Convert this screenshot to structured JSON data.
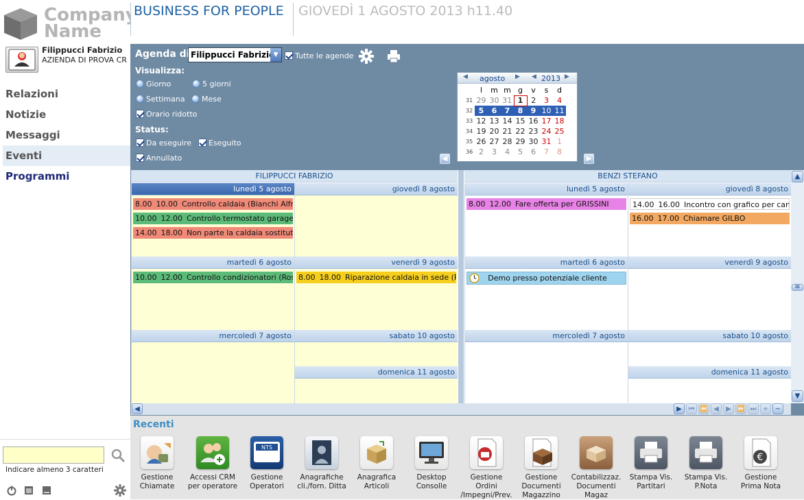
{
  "brand": {
    "company_line1": "Company",
    "company_line2": "Name"
  },
  "user": {
    "name": "Filippucci Fabrizio",
    "company": "AZIENDA DI PROVA CR"
  },
  "nav": [
    "Relazioni",
    "Notizie",
    "Messaggi",
    "Eventi",
    "Programmi"
  ],
  "search": {
    "value": "",
    "hint": "Indicare almeno 3 caratteri"
  },
  "header": {
    "title": "BUSINESS FOR PEOPLE",
    "datetime": "GIOVEDÌ 1 AGOSTO 2013 h11.40"
  },
  "agenda": {
    "label": "Agenda di",
    "selected": "Filippucci Fabrizio",
    "all_agendas": "Tutte le agende",
    "visualizza_label": "Visualizza:",
    "views": [
      "Giorno",
      "5 giorni",
      "Settimana",
      "Mese"
    ],
    "reduced_hours": "Orario ridotto",
    "status_label": "Status:",
    "status": [
      "Da eseguire",
      "Eseguito",
      "Annullato"
    ]
  },
  "calendar": {
    "month": "agosto",
    "year": "2013",
    "weekdays": [
      "l",
      "m",
      "m",
      "g",
      "v",
      "s",
      "d"
    ],
    "weeks": [
      {
        "wk": "31",
        "days": [
          "29",
          "30",
          "31",
          "1",
          "2",
          "3",
          "4"
        ]
      },
      {
        "wk": "32",
        "days": [
          "5",
          "6",
          "7",
          "8",
          "9",
          "10",
          "11"
        ]
      },
      {
        "wk": "33",
        "days": [
          "12",
          "13",
          "14",
          "15",
          "16",
          "17",
          "18"
        ]
      },
      {
        "wk": "34",
        "days": [
          "19",
          "20",
          "21",
          "22",
          "23",
          "24",
          "25"
        ]
      },
      {
        "wk": "35",
        "days": [
          "26",
          "27",
          "28",
          "29",
          "30",
          "31",
          "1"
        ]
      },
      {
        "wk": "36",
        "days": [
          "2",
          "3",
          "4",
          "5",
          "6",
          "7",
          "8"
        ]
      }
    ]
  },
  "schedule": {
    "people": [
      "FILIPPUCCI FABRIZIO",
      "BENZI STEFANO"
    ],
    "days": {
      "mon": "lunedì 5 agosto",
      "tue": "martedì 6 agosto",
      "wed": "mercoledì 7 agosto",
      "thu": "giovedì 8 agosto",
      "fri": "venerdì 9 agosto",
      "sat": "sabato 10 agosto",
      "sun": "domenica 11 agosto"
    },
    "events": {
      "p1_mon": [
        {
          "start": "8.00",
          "end": "10.00",
          "title": "Controllo caldaia (Bianchi Alfredo )",
          "color": "#f08a78"
        },
        {
          "start": "10.00",
          "end": "12.00",
          "title": "Controllo termostato garage (Prog",
          "color": "#5dbb79"
        },
        {
          "start": "14.00",
          "end": "18.00",
          "title": "Non parte la caldaia sostitutiva (R",
          "color": "#f08a78"
        }
      ],
      "p1_tue": [
        {
          "start": "10.00",
          "end": "12.00",
          "title": "Controllo condizionatori (Rossi Gib",
          "color": "#5dbb79"
        }
      ],
      "p1_fri": [
        {
          "start": "8.00",
          "end": "18.00",
          "title": "Riparazione caldaia in sede (Rossi",
          "color": "#f6cf1e"
        }
      ],
      "p2_mon": [
        {
          "start": "8.00",
          "end": "12.00",
          "title": "Fare offerta per GRISSINI",
          "color": "#e882e6"
        }
      ],
      "p2_thu": [
        {
          "start": "14.00",
          "end": "16.00",
          "title": "Incontro con grafico per campagn",
          "color": "#ffffff"
        },
        {
          "start": "16.00",
          "end": "17.00",
          "title": "Chiamare GILBO",
          "color": "#f2a860"
        }
      ],
      "p2_tue_allday": {
        "title": "Demo presso potenziale cliente",
        "color": "#9fd4ee"
      }
    }
  },
  "recenti": {
    "title": "Recenti",
    "apps": [
      {
        "label": "Gestione Chiamate",
        "icon": "phone-tools-icon"
      },
      {
        "label": "Accessi CRM per operatore",
        "icon": "users-add-icon"
      },
      {
        "label": "Gestione Operatori",
        "icon": "nts-icon"
      },
      {
        "label": "Anagrafiche cli./forn. Ditta",
        "icon": "contact-card-icon"
      },
      {
        "label": "Anagrafica Articoli",
        "icon": "box-icon"
      },
      {
        "label": "Desktop Consolle",
        "icon": "monitor-icon"
      },
      {
        "label": "Gestione Ordini /Impegni/Prev.",
        "icon": "order-doc-icon"
      },
      {
        "label": "Gestione Documenti Magazzino",
        "icon": "warehouse-doc-icon"
      },
      {
        "label": "Contabilizzaz. Documenti Magaz",
        "icon": "accounting-box-icon"
      },
      {
        "label": "Stampa Vis. Partitari",
        "icon": "printer-icon"
      },
      {
        "label": "Stampa Vis. P.Nota",
        "icon": "printer-icon"
      },
      {
        "label": "Gestione Prima Nota",
        "icon": "euro-doc-icon"
      }
    ]
  },
  "colors": {
    "panel": "#6f8aa3",
    "accent": "#1b5fa3",
    "nav_selected": "#e4edf5"
  }
}
